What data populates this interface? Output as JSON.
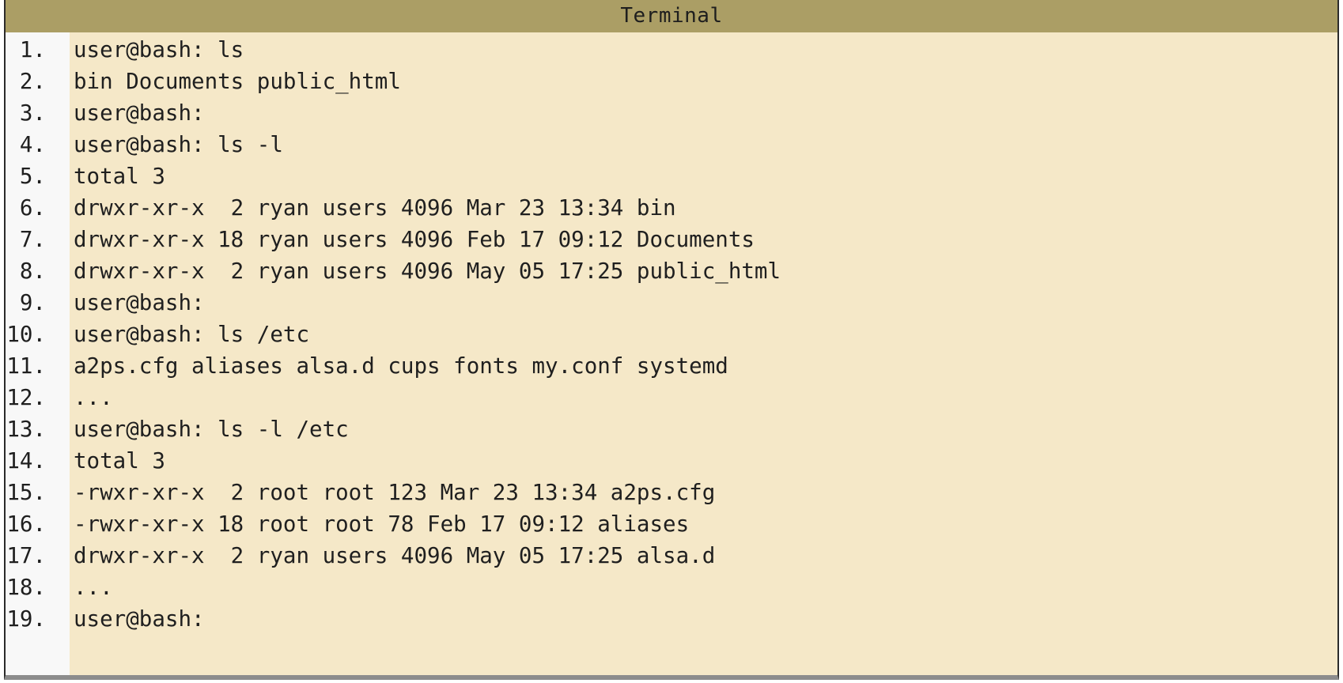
{
  "window": {
    "title": "Terminal"
  },
  "colors": {
    "titlebar": "#ab9e65",
    "background": "#f5e8c8",
    "gutter": "#f8f8f8",
    "text": "#1f1f1f"
  },
  "lines": [
    {
      "num": "1.",
      "text": "user@bash: ls"
    },
    {
      "num": "2.",
      "text": "bin Documents public_html"
    },
    {
      "num": "3.",
      "text": "user@bash:"
    },
    {
      "num": "4.",
      "text": "user@bash: ls -l"
    },
    {
      "num": "5.",
      "text": "total 3"
    },
    {
      "num": "6.",
      "text": "drwxr-xr-x  2 ryan users 4096 Mar 23 13:34 bin"
    },
    {
      "num": "7.",
      "text": "drwxr-xr-x 18 ryan users 4096 Feb 17 09:12 Documents"
    },
    {
      "num": "8.",
      "text": "drwxr-xr-x  2 ryan users 4096 May 05 17:25 public_html"
    },
    {
      "num": "9.",
      "text": "user@bash:"
    },
    {
      "num": "10.",
      "text": "user@bash: ls /etc"
    },
    {
      "num": "11.",
      "text": "a2ps.cfg aliases alsa.d cups fonts my.conf systemd"
    },
    {
      "num": "12.",
      "text": "..."
    },
    {
      "num": "13.",
      "text": "user@bash: ls -l /etc"
    },
    {
      "num": "14.",
      "text": "total 3"
    },
    {
      "num": "15.",
      "text": "-rwxr-xr-x  2 root root 123 Mar 23 13:34 a2ps.cfg"
    },
    {
      "num": "16.",
      "text": "-rwxr-xr-x 18 root root 78 Feb 17 09:12 aliases"
    },
    {
      "num": "17.",
      "text": "drwxr-xr-x  2 ryan users 4096 May 05 17:25 alsa.d"
    },
    {
      "num": "18.",
      "text": "..."
    },
    {
      "num": "19.",
      "text": "user@bash:"
    }
  ]
}
